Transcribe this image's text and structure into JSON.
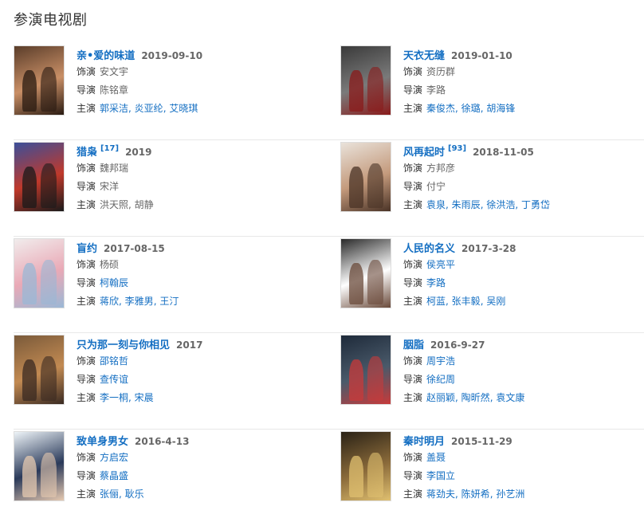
{
  "section_title": "参演电视剧",
  "labels": {
    "role": "饰演",
    "director": "导演",
    "cast": "主演"
  },
  "items": [
    {
      "title": "亲•爱的味道",
      "sup": "",
      "date": "2019-09-10",
      "role": "安文宇",
      "director": "陈铭章",
      "cast": [
        "郭采洁",
        "炎亚纶",
        "艾晓琪"
      ],
      "role_link": false,
      "director_link": false,
      "cast_link": true,
      "poster_colors": [
        "#5a3d2a",
        "#c98f66",
        "#2a1b12"
      ]
    },
    {
      "title": "天衣无缝",
      "sup": "",
      "date": "2019-01-10",
      "role": "资历群",
      "director": "李路",
      "cast": [
        "秦俊杰",
        "徐璐",
        "胡海锋"
      ],
      "role_link": false,
      "director_link": false,
      "cast_link": true,
      "poster_colors": [
        "#3a3a3a",
        "#7a7a7a",
        "#8a1a1a"
      ]
    },
    {
      "title": "猎枭",
      "sup": "[17]",
      "date": "2019",
      "role": "魏邦瑞",
      "director": "宋洋",
      "cast": [
        "洪天照",
        "胡静"
      ],
      "role_link": false,
      "director_link": false,
      "cast_link": false,
      "poster_colors": [
        "#3b4f9a",
        "#c0392b",
        "#1a1a1a"
      ]
    },
    {
      "title": "风再起时",
      "sup": "[93]",
      "date": "2018-11-05",
      "role": "方邦彦",
      "director": "付宁",
      "cast": [
        "袁泉",
        "朱雨辰",
        "徐洪浩",
        "丁勇岱"
      ],
      "role_link": false,
      "director_link": false,
      "cast_link": true,
      "poster_colors": [
        "#e9e2da",
        "#c49a7c",
        "#4a3326"
      ]
    },
    {
      "title": "盲约",
      "sup": "",
      "date": "2017-08-15",
      "role": "杨硕",
      "director": "柯翰辰",
      "cast": [
        "蒋欣",
        "李雅男",
        "王汀"
      ],
      "role_link": false,
      "director_link": true,
      "cast_link": true,
      "poster_colors": [
        "#f1ecec",
        "#e9a9b6",
        "#9ab8d6"
      ]
    },
    {
      "title": "人民的名义",
      "sup": "",
      "date": "2017-3-28",
      "role": "侯亮平",
      "director": "李路",
      "cast": [
        "柯蓝",
        "张丰毅",
        "吴刚"
      ],
      "role_link": true,
      "director_link": true,
      "cast_link": true,
      "poster_colors": [
        "#2a2a2a",
        "#ffffff",
        "#6a4a3a"
      ]
    },
    {
      "title": "只为那一刻与你相见",
      "sup": "",
      "date": "2017",
      "role": "邵铭哲",
      "director": "查传谊",
      "cast": [
        "李一桐",
        "宋晨"
      ],
      "role_link": true,
      "director_link": true,
      "cast_link": true,
      "poster_colors": [
        "#7a5a3a",
        "#c28a52",
        "#3a2a22"
      ]
    },
    {
      "title": "胭脂",
      "sup": "",
      "date": "2016-9-27",
      "role": "周宇浩",
      "director": "徐纪周",
      "cast": [
        "赵丽颖",
        "陶昕然",
        "袁文康"
      ],
      "role_link": true,
      "director_link": true,
      "cast_link": true,
      "poster_colors": [
        "#1e2a3a",
        "#4a5a6a",
        "#c83a3a"
      ]
    },
    {
      "title": "致单身男女",
      "sup": "",
      "date": "2016-4-13",
      "role": "方启宏",
      "director": "蔡晶盛",
      "cast": [
        "张俪",
        "耿乐"
      ],
      "role_link": true,
      "director_link": true,
      "cast_link": true,
      "poster_colors": [
        "#eef4f8",
        "#2a3a5a",
        "#e6c9b0"
      ]
    },
    {
      "title": "秦时明月",
      "sup": "",
      "date": "2015-11-29",
      "role": "盖聂",
      "director": "李国立",
      "cast": [
        "蒋劲夫",
        "陈妍希",
        "孙艺洲"
      ],
      "role_link": true,
      "director_link": true,
      "cast_link": true,
      "poster_colors": [
        "#2a2216",
        "#8a6a3a",
        "#e0c070"
      ]
    }
  ]
}
